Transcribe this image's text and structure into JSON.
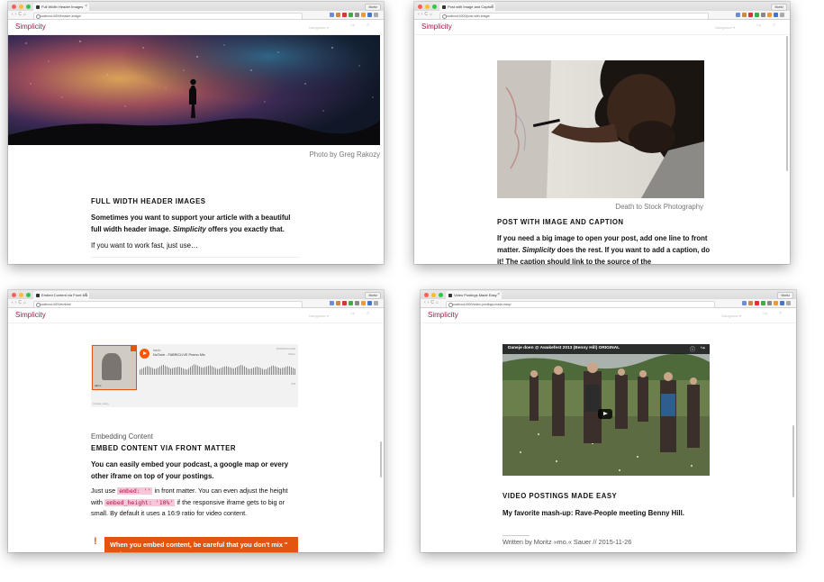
{
  "colors": {
    "brand": "#a4174b",
    "alert": "#e2540f"
  },
  "windows": [
    {
      "tab_title": "Full Width Header Images",
      "url": "localhost:4000/header-image/",
      "user": "Moritz",
      "brand": "Simplicity",
      "nav_label": "Navigation ▾",
      "caption": "Photo by Greg Rakozy",
      "heading": "FULL WIDTH HEADER IMAGES",
      "lead_before": "Sometimes you want to support your article with a beautiful full width header image. ",
      "lead_em": "Simplicity",
      "lead_after": " offers you exactly that.",
      "para": "If you want to work fast, just use…"
    },
    {
      "tab_title": "Post with Image and Caption",
      "url": "localhost:4000/post-with-image/",
      "user": "Moritz",
      "brand": "Simplicity",
      "nav_label": "Navigation ▾",
      "caption": "Death to Stock Photography",
      "heading": "POST WITH IMAGE AND CAPTION",
      "lead_before": "If you need a big image to open your post, add one line to front matter. ",
      "lead_em": "Simplicity",
      "lead_after": " does the rest. If you want to add a caption, do it! The caption should link to the source of the"
    },
    {
      "tab_title": "Embed Content via Front Ma",
      "url": "localhost:4000/embed/",
      "user": "Moritz",
      "brand": "Simplicity",
      "nav_label": "Navigation ▾",
      "embed": {
        "artist": "fabric",
        "track": "NuTone - FABRICLIVE Promo Mix",
        "meta": "SOUNDCLOUD",
        "share": "Share",
        "plays": "378",
        "footer": "Cookie policy"
      },
      "category": "Embedding Content",
      "heading": "EMBED CONTENT VIA FRONT MATTER",
      "lead": "You can easily embed your podcast, a google map or every other iframe on top of your postings.",
      "p1_a": "Just use ",
      "code1": "embed: ''",
      "p1_b": " in front matter. You can even adjust the height with ",
      "code2": "embed_height: '10%'",
      "p1_c": " if the responsive iframe gets to big or small. By default it uses a 16:9 ratio for video content.",
      "alert_mark": "!",
      "alert": "When you embed content, be careful that you don't mix \" and '"
    },
    {
      "tab_title": "Video Postings Made Easy",
      "url": "localhost:4000/video-postings-made-easy/",
      "user": "Moritz",
      "brand": "Simplicity",
      "nav_label": "Navigation ▾",
      "video_title": "Daneje doen @ Awakefest 2013 (Benny Hill) ORIGINAL",
      "heading": "VIDEO POSTINGS MADE EASY",
      "lead": "My favorite mash-up: Rave-People meeting Benny Hill.",
      "byline": "Written by Moritz »mo.« Sauer // 2015-11-26"
    }
  ]
}
